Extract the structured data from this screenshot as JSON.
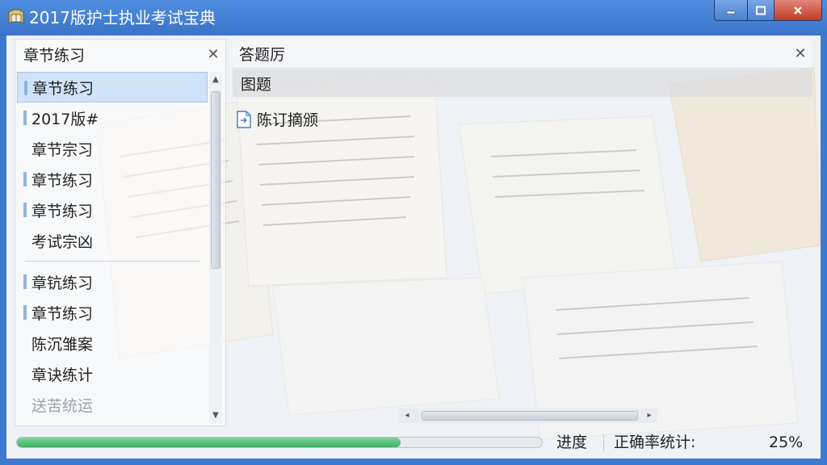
{
  "window": {
    "title": "2017版护士执业考试宝典"
  },
  "left_panel": {
    "title": "章节练习",
    "items": [
      {
        "label": "章节练习",
        "selected": true,
        "marked": true
      },
      {
        "label": "2017版#",
        "selected": false,
        "marked": true
      },
      {
        "label": "章节宗习",
        "selected": false,
        "marked": false
      },
      {
        "label": "章节练习",
        "selected": false,
        "marked": true
      },
      {
        "label": "章节练习",
        "selected": false,
        "marked": true
      },
      {
        "label": "考试宗凶",
        "selected": false,
        "marked": false
      },
      {
        "label": "章钪练习",
        "selected": false,
        "marked": true
      },
      {
        "label": "章节练习",
        "selected": false,
        "marked": true
      },
      {
        "label": "陈沉雏案",
        "selected": false,
        "marked": false
      },
      {
        "label": "章诀练计",
        "selected": false,
        "marked": false
      },
      {
        "label": "送苦统运",
        "selected": false,
        "marked": false,
        "faded": true
      }
    ]
  },
  "right_panel": {
    "title": "答题厉",
    "section_label": "图题",
    "item_label": "陈订摘颁"
  },
  "status": {
    "progress_fraction": 0.73,
    "progress_label": "进度",
    "accuracy_label": "正确率统计:",
    "accuracy_value": "25%"
  },
  "icons": {
    "app": "book-icon",
    "minimize": "minimize-icon",
    "maximize": "maximize-icon",
    "close": "close-icon",
    "doc": "document-icon"
  },
  "colors": {
    "titlebar": "#3d79cf",
    "progress": "#4cba72",
    "selection": "#cfe2f7"
  }
}
